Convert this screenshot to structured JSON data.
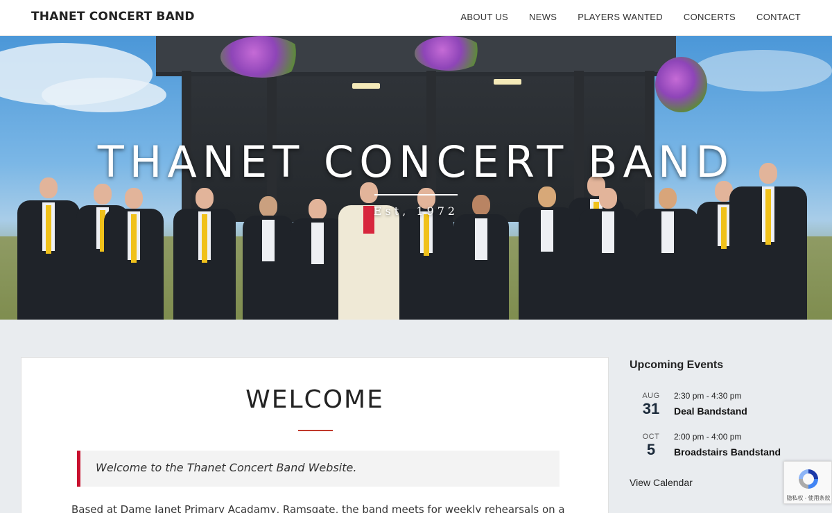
{
  "header": {
    "site_title": "THANET CONCERT BAND",
    "nav": [
      {
        "label": "ABOUT US"
      },
      {
        "label": "NEWS"
      },
      {
        "label": "PLAYERS WANTED"
      },
      {
        "label": "CONCERTS"
      },
      {
        "label": "CONTACT"
      }
    ]
  },
  "hero": {
    "title": "THANET CONCERT BAND",
    "subtitle": "Est, 1972"
  },
  "main": {
    "heading": "WELCOME",
    "quote": "Welcome to the Thanet Concert Band Website.",
    "body_text": "Based at Dame Janet Primary Acadamy, Ramsgate, the band meets for weekly rehearsals on a"
  },
  "sidebar": {
    "title": "Upcoming Events",
    "events": [
      {
        "month": "AUG",
        "day": "31",
        "time": "2:30 pm - 4:30 pm",
        "location": "Deal Bandstand"
      },
      {
        "month": "OCT",
        "day": "5",
        "time": "2:00 pm - 4:00 pm",
        "location": "Broadstairs Bandstand"
      }
    ],
    "view_calendar": "View Calendar"
  },
  "recaptcha": {
    "text": "隐私权 - 使用条款",
    "icon": "recaptcha-icon"
  },
  "colors": {
    "accent_red": "#c8102e",
    "tie_yellow": "#f0c11b",
    "page_bg": "#e9ecef"
  }
}
